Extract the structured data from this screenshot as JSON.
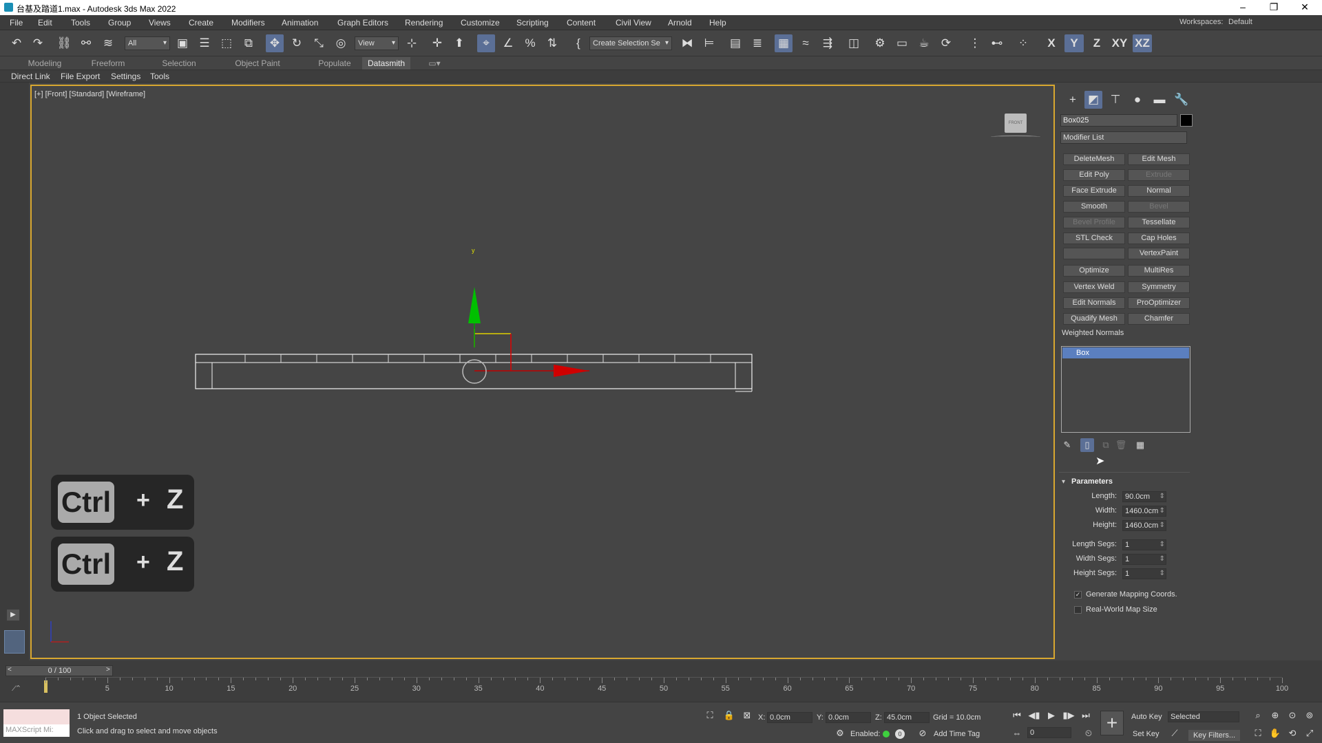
{
  "title_bar": {
    "title": "台基及踏道1.max - Autodesk 3ds Max 2022",
    "minimize": "–",
    "restore": "❐",
    "close": "✕"
  },
  "menu": {
    "items": [
      "File",
      "Edit",
      "Tools",
      "Group",
      "Views",
      "Create",
      "Modifiers",
      "Animation",
      "Graph Editors",
      "Rendering",
      "Customize",
      "Scripting",
      "Content",
      "Civil View",
      "Arnold",
      "Help"
    ],
    "workspaces_label": "Workspaces:",
    "workspaces_value": "Default"
  },
  "toolbar": {
    "selection_filter": "All",
    "reference_coord": "View",
    "create_selection_set": "Create Selection Se",
    "axis_x": "X",
    "axis_y": "Y",
    "axis_z": "Z",
    "axis_xy": "XY",
    "axis_xz": "XZ"
  },
  "ribbon": {
    "tabs": [
      "Modeling",
      "Freeform",
      "Selection",
      "Object Paint",
      "Populate",
      "Datasmith"
    ],
    "active_tab": "Datasmith"
  },
  "ribbon2": {
    "items": [
      "Direct Link",
      "File Export",
      "Settings",
      "Tools"
    ]
  },
  "viewport": {
    "label": "[+] [Front] [Standard] [Wireframe]",
    "gizmo_y": "y",
    "viewcube_label": "FRONT"
  },
  "keyboard_overlay": {
    "key1": "Ctrl",
    "plus1": "+",
    "z1": "Z",
    "key2": "Ctrl",
    "plus2": "+",
    "z2": "Z"
  },
  "command_panel": {
    "object_name": "Box025",
    "object_color": "#000000",
    "modifier_list": "Modifier List",
    "modifier_buttons": [
      {
        "label": "DeleteMesh",
        "enabled": true
      },
      {
        "label": "Edit Mesh",
        "enabled": true
      },
      {
        "label": "Edit Poly",
        "enabled": true
      },
      {
        "label": "Extrude",
        "enabled": false
      },
      {
        "label": "Face Extrude",
        "enabled": true
      },
      {
        "label": "Normal",
        "enabled": true
      },
      {
        "label": "Smooth",
        "enabled": true
      },
      {
        "label": "Bevel",
        "enabled": false
      },
      {
        "label": "Bevel Profile",
        "enabled": false
      },
      {
        "label": "Tessellate",
        "enabled": true
      },
      {
        "label": "STL Check",
        "enabled": true
      },
      {
        "label": "Cap Holes",
        "enabled": true
      },
      {
        "label": "",
        "enabled": true
      },
      {
        "label": "VertexPaint",
        "enabled": true
      },
      {
        "label": "Optimize",
        "enabled": true
      },
      {
        "label": "MultiRes",
        "enabled": true
      },
      {
        "label": "Vertex Weld",
        "enabled": true
      },
      {
        "label": "Symmetry",
        "enabled": true
      },
      {
        "label": "Edit Normals",
        "enabled": true
      },
      {
        "label": "ProOptimizer",
        "enabled": true
      },
      {
        "label": "Quadify Mesh",
        "enabled": true
      },
      {
        "label": "Chamfer",
        "enabled": true
      }
    ],
    "weighted_normals": "Weighted Normals",
    "stack_item": "Box",
    "parameters_title": "Parameters",
    "params": [
      {
        "label": "Length:",
        "value": "90.0cm"
      },
      {
        "label": "Width:",
        "value": "1460.0cm"
      },
      {
        "label": "Height:",
        "value": "1460.0cm"
      }
    ],
    "segs": [
      {
        "label": "Length Segs:",
        "value": "1"
      },
      {
        "label": "Width Segs:",
        "value": "1"
      },
      {
        "label": "Height Segs:",
        "value": "1"
      }
    ],
    "gen_mapping": "Generate Mapping Coords.",
    "gen_mapping_checked": true,
    "real_world": "Real-World Map Size",
    "real_world_checked": false
  },
  "timeline": {
    "frame_display": "0 / 100",
    "ticks": [
      "5",
      "10",
      "15",
      "20",
      "25",
      "30",
      "35",
      "40",
      "45",
      "50",
      "55",
      "60",
      "65",
      "70",
      "75",
      "80",
      "85",
      "90",
      "95",
      "100"
    ]
  },
  "status": {
    "maxscript": "MAXScript Mi:",
    "objects_selected": "1 Object Selected",
    "prompt": "Click and drag to select and move objects",
    "x_label": "X:",
    "x_value": "0.0cm",
    "y_label": "Y:",
    "y_value": "0.0cm",
    "z_label": "Z:",
    "z_value": "45.0cm",
    "grid": "Grid = 10.0cm",
    "enabled": "Enabled:",
    "add_time_tag": "Add Time Tag",
    "auto_key": "Auto Key",
    "selected": "Selected",
    "set_key": "Set Key",
    "key_filters": "Key Filters...",
    "frame_value": "0"
  }
}
